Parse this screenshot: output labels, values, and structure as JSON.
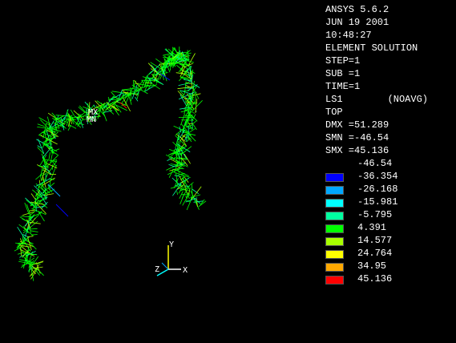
{
  "info": {
    "version": "ANSYS 5.6.2",
    "date": "JUN 19 2001",
    "time": "10:48:27",
    "solution_type": "ELEMENT SOLUTION",
    "step": "STEP=1",
    "sub": "SUB =1",
    "time_value": "TIME=1",
    "load_step": "LS1",
    "avg_mode": "(NOAVG)",
    "layer": "TOP",
    "dmx": "DMX =51.289",
    "smn": "SMN =-46.54",
    "smx": "SMX =45.136"
  },
  "contour_min": "-46.54",
  "contours": [
    {
      "value": "-36.354",
      "color": "#0000ff"
    },
    {
      "value": "-26.168",
      "color": "#00a8ff"
    },
    {
      "value": "-15.981",
      "color": "#00ffff"
    },
    {
      "value": "-5.795",
      "color": "#00ffa0"
    },
    {
      "value": "4.391",
      "color": "#00ff00"
    },
    {
      "value": "14.577",
      "color": "#a8ff00"
    },
    {
      "value": "24.764",
      "color": "#ffff00"
    },
    {
      "value": "34.95",
      "color": "#ffa800"
    },
    {
      "value": "45.136",
      "color": "#ff0000"
    }
  ],
  "triad": {
    "y": "Y",
    "z": "Z",
    "x": "X"
  },
  "markers": {
    "mx": "MX",
    "mn": "MN"
  }
}
